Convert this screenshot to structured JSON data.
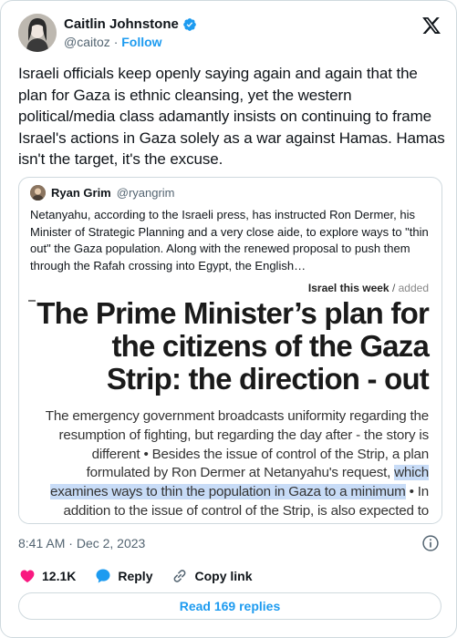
{
  "author": {
    "name": "Caitlin Johnstone",
    "handle": "@caitoz",
    "separator": "·",
    "follow_label": "Follow"
  },
  "tweet": {
    "text": "Israeli officials keep openly saying again and again that the plan for Gaza is ethnic cleansing, yet the western political/media class adamantly insists on continuing to frame Israel's actions in Gaza solely as a war against Hamas. Hamas isn't the target, it's the excuse."
  },
  "quote": {
    "name": "Ryan Grim",
    "handle": "@ryangrim",
    "text": "Netanyahu, according to the Israeli press, has instructed Ron Dermer, his Minister of Strategic Planning and a very close aide, to explore ways to \"thin out\" the Gaza population. Along with the renewed proposal to push them through the Rafah crossing into Egypt, the English…",
    "image": {
      "source_name": "Israel this week",
      "source_sep": " / ",
      "source_added": "added",
      "headline": "The Prime Minister’s plan for the citizens of the Gaza Strip: the direction - out",
      "article_pre": "The emergency government broadcasts uniformity regarding the resumption of fighting, but regarding the day after - the story is different • Besides the issue of control of the Strip, a plan formulated by Ron Dermer at Netanyahu's request, ",
      "article_highlight": "which examines ways to thin the population in Gaza to a minimum",
      "article_post": " • In addition to the issue of control of the Strip, is also expected to cause controversy considers it an unrealistic fantasy"
    }
  },
  "meta": {
    "time": "8:41 AM",
    "separator": "·",
    "date": "Dec 2, 2023"
  },
  "actions": {
    "likes": "12.1K",
    "reply_label": "Reply",
    "copy_label": "Copy link"
  },
  "replies_button": "Read 169 replies",
  "colors": {
    "accent": "#1d9bf0",
    "like": "#f91880",
    "muted": "#536471",
    "highlight": "#c8dcf7"
  },
  "icons": [
    "verified-badge-icon",
    "x-logo-icon",
    "info-icon",
    "heart-icon",
    "reply-bubble-icon",
    "link-icon"
  ]
}
